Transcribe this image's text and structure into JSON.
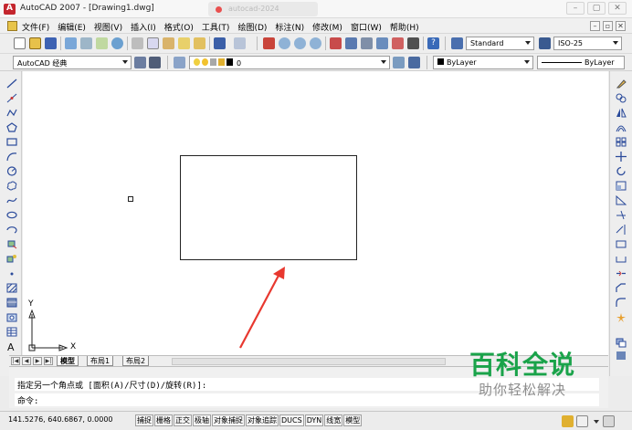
{
  "window": {
    "title": "AutoCAD 2007 - [Drawing1.dwg]",
    "ghost_tab": "autocad-2024",
    "controls": [
      "–",
      "▢",
      "✕"
    ]
  },
  "menubar": {
    "items": [
      "文件(F)",
      "编辑(E)",
      "视图(V)",
      "插入(I)",
      "格式(O)",
      "工具(T)",
      "绘图(D)",
      "标注(N)",
      "修改(M)",
      "窗口(W)",
      "帮助(H)"
    ],
    "doc_controls": [
      "–",
      "▫",
      "✕"
    ]
  },
  "toolbar_top": {
    "text_style": "Standard",
    "dim_style": "ISO-25"
  },
  "toolbar_layers": {
    "workspace": "AutoCAD 经典",
    "layer_name": "0",
    "color": "ByLayer",
    "linetype": "ByLayer"
  },
  "canvas": {
    "ucs_x": "X",
    "ucs_y": "Y"
  },
  "layout_tabs": [
    "模型",
    "布局1",
    "布局2"
  ],
  "layout_nav": [
    "|◀",
    "◀",
    "▶",
    "▶|"
  ],
  "command": {
    "history": "指定另一个角点或 [面积(A)/尺寸(D)/旋转(R)]:",
    "prompt": "命令:"
  },
  "status": {
    "coords": "141.5276, 640.6867, 0.0000",
    "toggles": [
      "捕捉",
      "栅格",
      "正交",
      "极轴",
      "对象捕捉",
      "对象追踪",
      "DUCS",
      "DYN",
      "线宽",
      "模型"
    ]
  },
  "watermark": {
    "main": "百科全说",
    "sub": "助你轻松解决"
  },
  "colors": {
    "arrow": "#e8382f",
    "watermark_green": "#1aa34a",
    "canvas_bg": "#ffffff"
  }
}
